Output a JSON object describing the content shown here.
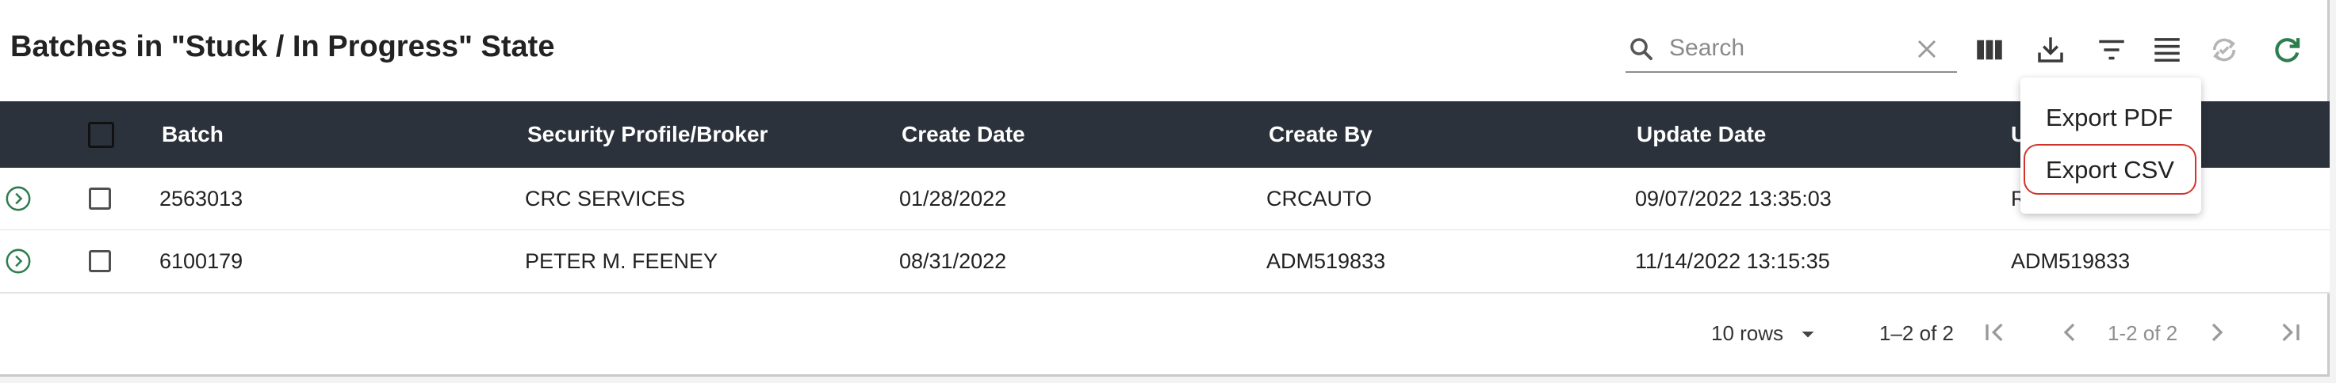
{
  "page": {
    "title": "Batches in \"Stuck / In Progress\" State"
  },
  "search": {
    "placeholder": "Search"
  },
  "toolbar": {
    "icons": [
      "search-icon",
      "clear-icon",
      "view-columns-icon",
      "download-icon",
      "filter-icon",
      "density-icon",
      "sync-disabled-icon",
      "refresh-icon"
    ]
  },
  "table": {
    "columns": [
      "Batch",
      "Security Profile/Broker",
      "Create Date",
      "Create By",
      "Update Date",
      "U"
    ],
    "rows": [
      {
        "batch": "2563013",
        "broker": "CRC SERVICES",
        "create_date": "01/28/2022",
        "create_by": "CRCAUTO",
        "update_date": "09/07/2022 13:35:03",
        "update_by": "R"
      },
      {
        "batch": "6100179",
        "broker": "PETER M. FEENEY",
        "create_date": "08/31/2022",
        "create_by": "ADM519833",
        "update_date": "11/14/2022 13:15:35",
        "update_by": "ADM519833"
      }
    ]
  },
  "pagination": {
    "rows_per_page": "10 rows",
    "range": "1–2 of 2",
    "page_label": "1-2 of 2"
  },
  "export_menu": {
    "items": [
      "Export PDF",
      "Export CSV"
    ],
    "selected": "Export CSV"
  },
  "colors": {
    "header_bg": "#2c323b",
    "accent_green": "#2e7d4f",
    "highlight_red": "#d0342c"
  }
}
